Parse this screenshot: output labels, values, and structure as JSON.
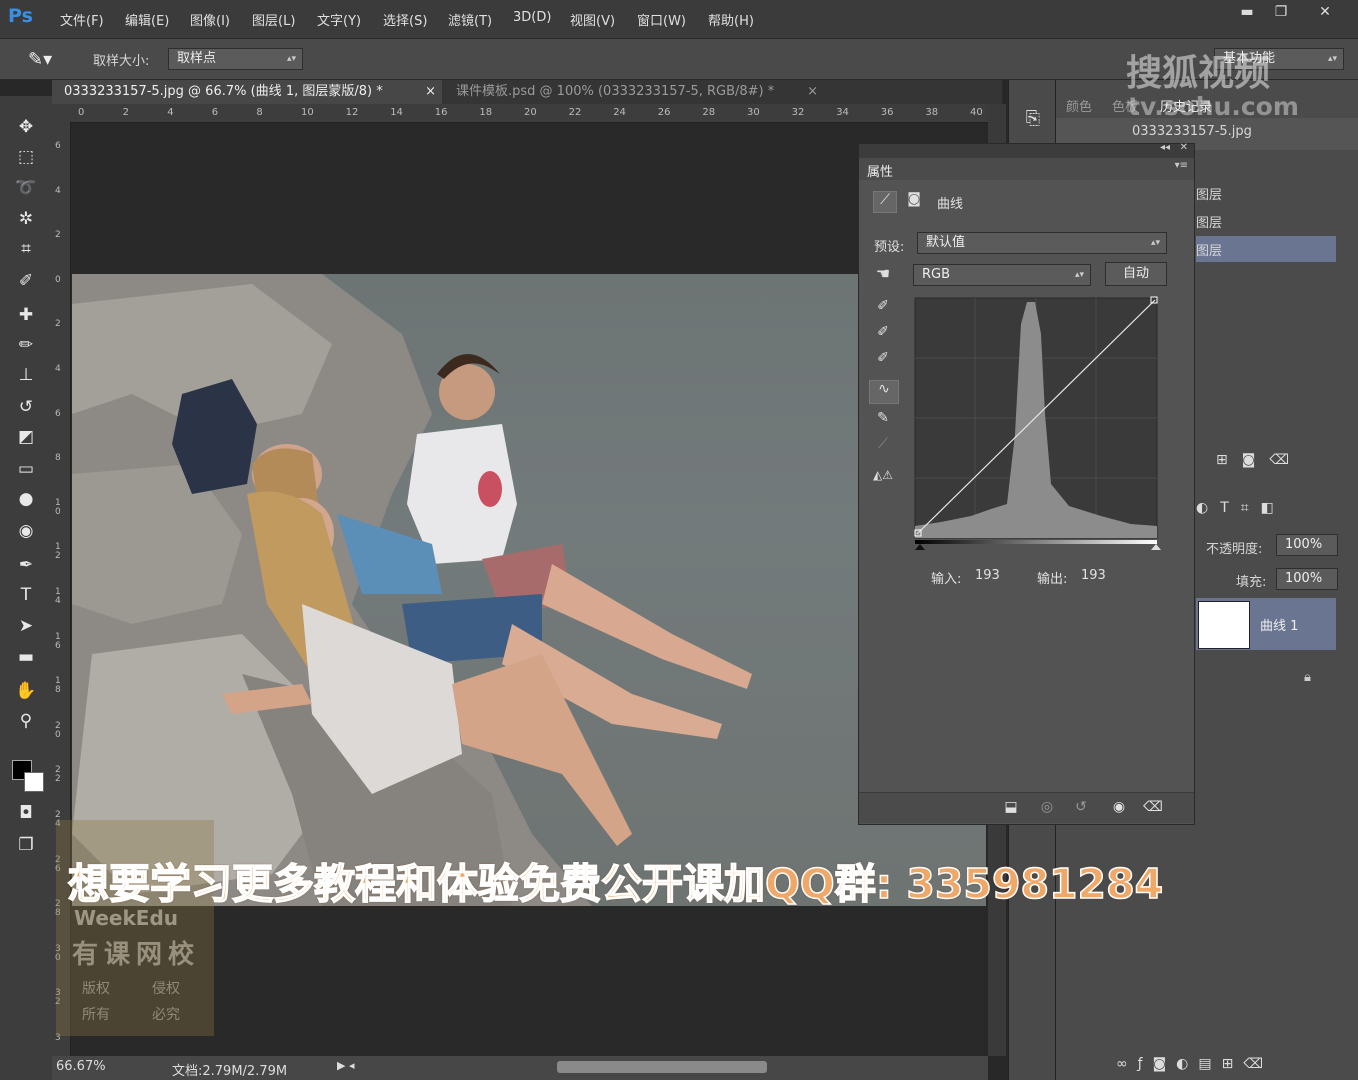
{
  "app": {
    "logo": "Ps"
  },
  "menu": [
    "文件(F)",
    "编辑(E)",
    "图像(I)",
    "图层(L)",
    "文字(Y)",
    "选择(S)",
    "滤镜(T)",
    "3D(D)",
    "视图(V)",
    "窗口(W)",
    "帮助(H)"
  ],
  "window_controls": {
    "minimize": "▬",
    "restore": "❐",
    "close": "✕"
  },
  "options": {
    "sample_size_label": "取样大小:",
    "sample_size_value": "取样点",
    "workspace": "基本功能"
  },
  "tabs": [
    {
      "label": "0333233157-5.jpg @ 66.7% (曲线 1, 图层蒙版/8) *",
      "close": "×"
    },
    {
      "label": "课件模板.psd @ 100% (0333233157-5, RGB/8#) *",
      "close": "×"
    }
  ],
  "ruler_h": [
    "0",
    "2",
    "4",
    "6",
    "8",
    "10",
    "12",
    "14",
    "16",
    "18",
    "20",
    "22",
    "24",
    "26",
    "28",
    "30",
    "32",
    "34",
    "36",
    "38",
    "40"
  ],
  "ruler_v": [
    "6",
    "4",
    "2",
    "0",
    "2",
    "4",
    "6",
    "8",
    "1 0",
    "1 2",
    "1 4",
    "1 6",
    "1 8",
    "2 0",
    "2 2",
    "2 4",
    "2 6",
    "2 8",
    "3 0",
    "3 2",
    "3"
  ],
  "status": {
    "zoom": "66.67%",
    "doc": "文档:2.79M/2.79M"
  },
  "right_tabs": {
    "color": "颜色",
    "swatches": "色板",
    "history": "历史记录"
  },
  "history": {
    "snapshot": "0333233157-5.jpg",
    "items": [
      "图层",
      "图层",
      "图层"
    ]
  },
  "properties": {
    "title": "属性",
    "type_label": "曲线",
    "preset_label": "预设:",
    "preset_value": "默认值",
    "channel_value": "RGB",
    "auto_label": "自动",
    "input_label": "输入:",
    "input_value": "193",
    "output_label": "输出:",
    "output_value": "193"
  },
  "layers": {
    "opacity_label": "不透明度:",
    "opacity_value": "100%",
    "fill_label": "填充:",
    "fill_value": "100%",
    "layer_name": "曲线 1"
  },
  "banner": "想要学习更多教程和体验免费公开课加QQ群: 335981284",
  "watermark": {
    "sohu": "搜狐视频",
    "sohu_url": "tv.sohu.com",
    "weekedu": "WeekEdu",
    "weekedu_cn": "有课网校",
    "weekedu_small1": "版权",
    "weekedu_small2": "所有",
    "weekedu_small3": "侵权",
    "weekedu_small4": "必究"
  }
}
